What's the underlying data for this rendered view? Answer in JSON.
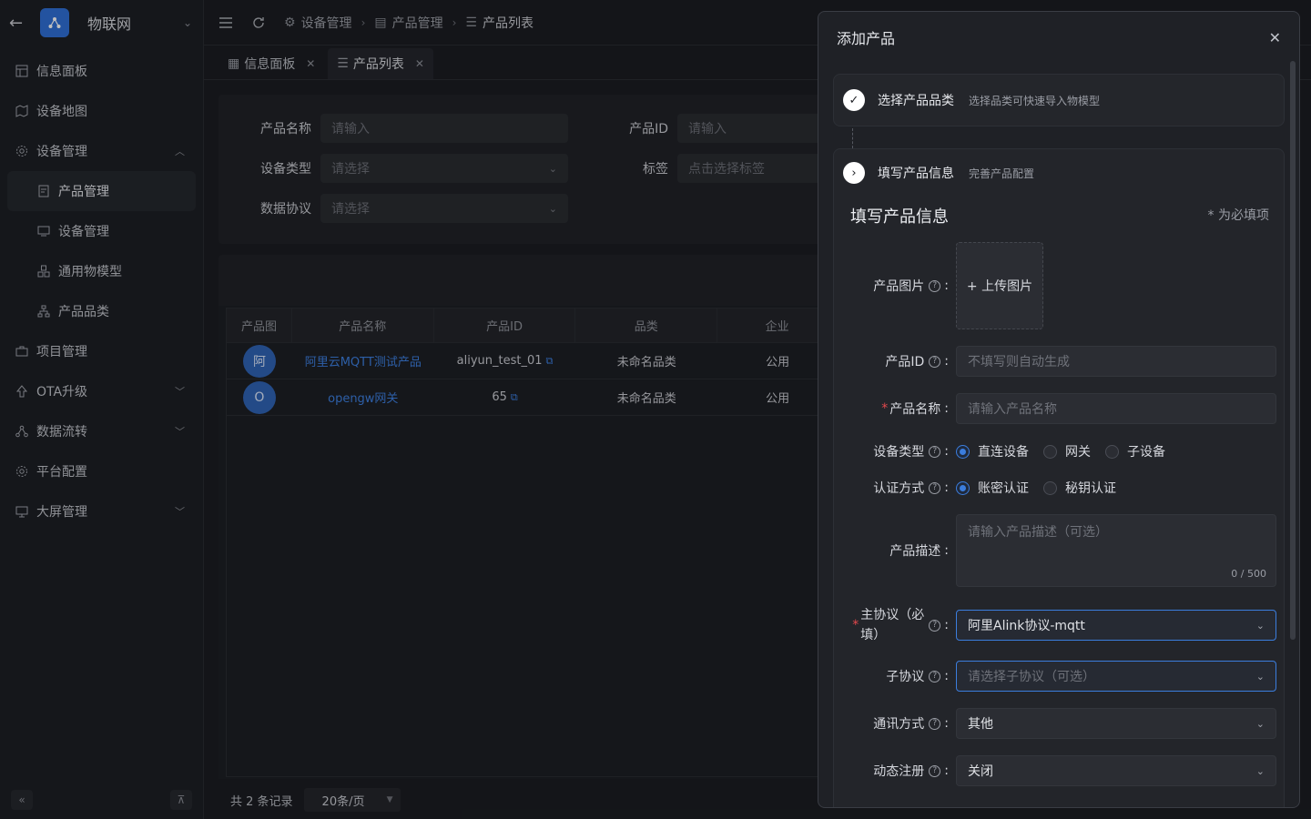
{
  "app": {
    "title": "物联网"
  },
  "sidebar": {
    "items": [
      {
        "label": "信息面板"
      },
      {
        "label": "设备地图"
      },
      {
        "label": "设备管理"
      },
      {
        "label": "产品管理"
      },
      {
        "label": "设备管理"
      },
      {
        "label": "通用物模型"
      },
      {
        "label": "产品品类"
      },
      {
        "label": "项目管理"
      },
      {
        "label": "OTA升级"
      },
      {
        "label": "数据流转"
      },
      {
        "label": "平台配置"
      },
      {
        "label": "大屏管理"
      }
    ]
  },
  "breadcrumb": {
    "items": [
      "设备管理",
      "产品管理",
      "产品列表"
    ]
  },
  "tabs": [
    {
      "label": "信息面板"
    },
    {
      "label": "产品列表"
    }
  ],
  "filter": {
    "product_name_label": "产品名称",
    "product_name_placeholder": "请输入",
    "product_id_label": "产品ID",
    "product_id_placeholder": "请输入",
    "device_type_label": "设备类型",
    "device_type_placeholder": "请选择",
    "tag_label": "标签",
    "tag_placeholder": "点击选择标签",
    "protocol_label": "数据协议",
    "protocol_placeholder": "请选择"
  },
  "table": {
    "headers": [
      "产品图",
      "产品名称",
      "产品ID",
      "品类",
      "企业"
    ],
    "rows": [
      {
        "avatar": "阿",
        "name": "阿里云MQTT测试产品",
        "id": "aliyun_test_01",
        "category": "未命名品类",
        "company": "公用"
      },
      {
        "avatar": "O",
        "name": "opengw网关",
        "id": "65",
        "category": "未命名品类",
        "company": "公用"
      }
    ]
  },
  "pager": {
    "total": "共 2 条记录",
    "page_size": "20条/页"
  },
  "drawer": {
    "title": "添加产品",
    "step1": {
      "title": "选择产品品类",
      "desc": "选择品类可快速导入物模型"
    },
    "step2": {
      "title": "填写产品信息",
      "desc": "完善产品配置"
    },
    "section_title": "填写产品信息",
    "required_note": "* 为必填项",
    "form": {
      "image_label": "产品图片",
      "upload_label": "+ 上传图片",
      "id_label": "产品ID",
      "id_placeholder": "不填写则自动生成",
      "name_label": "产品名称",
      "name_placeholder": "请输入产品名称",
      "device_type_label": "设备类型",
      "device_type_options": [
        "直连设备",
        "网关",
        "子设备"
      ],
      "auth_label": "认证方式",
      "auth_options": [
        "账密认证",
        "秘钥认证"
      ],
      "desc_label": "产品描述",
      "desc_placeholder": "请输入产品描述（可选）",
      "desc_count": "0 / 500",
      "main_protocol_label_1": "主协议（必",
      "main_protocol_label_2": "填）",
      "main_protocol_value": "阿里Alink协议-mqtt",
      "sub_protocol_label": "子协议",
      "sub_protocol_placeholder": "请选择子协议（可选）",
      "comm_label": "通讯方式",
      "comm_value": "其他",
      "dyn_label": "动态注册",
      "dyn_value": "关闭"
    }
  }
}
